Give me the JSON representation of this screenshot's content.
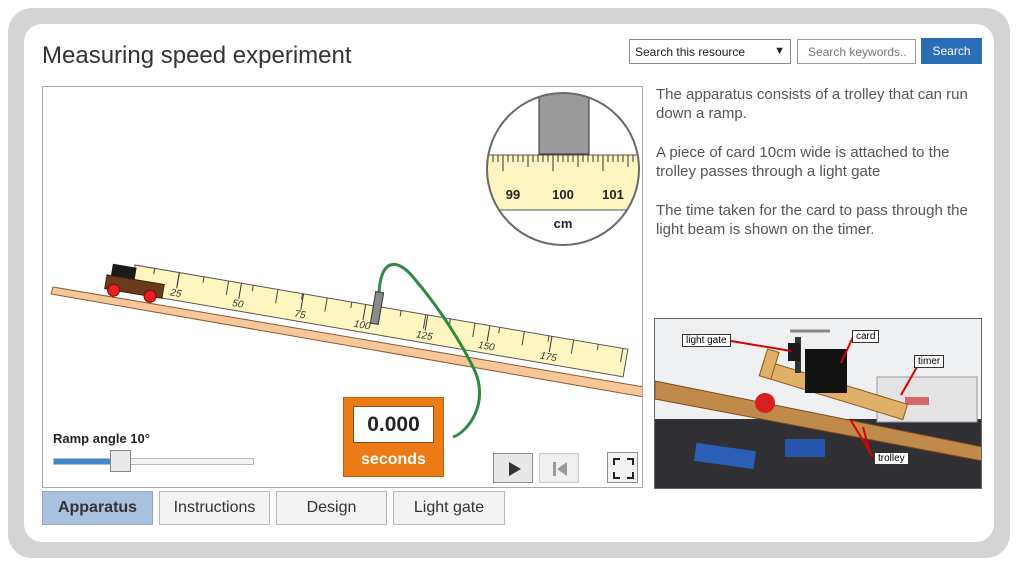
{
  "title": "Measuring speed experiment",
  "search": {
    "scope": "Search this resource",
    "placeholder": "Search keywords..",
    "button": "Search"
  },
  "description": [
    "The apparatus consists of a trolley that can run down a ramp.",
    "A piece of card 10cm wide is attached to the trolley passes through a light gate",
    "The time taken for the card to pass through the light beam is shown on the timer."
  ],
  "ruler_ticks": [
    "25",
    "50",
    "75",
    "100",
    "125",
    "150",
    "175"
  ],
  "magnifier": {
    "ticks": [
      "99",
      "100",
      "101"
    ],
    "unit": "cm"
  },
  "timer": {
    "value": "0.000",
    "unit": "seconds"
  },
  "ramp": {
    "label": "Ramp angle 10°",
    "angle": 10,
    "slider_fraction": 0.33
  },
  "photo_labels": {
    "light_gate": "light gate",
    "card": "card",
    "timer": "timer",
    "trolley": "trolley"
  },
  "tabs": [
    "Apparatus",
    "Instructions",
    "Design",
    "Light gate"
  ],
  "active_tab": 0,
  "icons": {
    "play": "play-icon",
    "reset": "skip-back-icon",
    "fullscreen": "fullscreen-icon",
    "dropdown": "chevron-down-icon"
  },
  "colors": {
    "accent": "#2a6fb6",
    "timer": "#ec7a16",
    "active_tab": "#a9c2e0",
    "cable": "#2d8a3e",
    "ruler": "#fdf6c1"
  }
}
